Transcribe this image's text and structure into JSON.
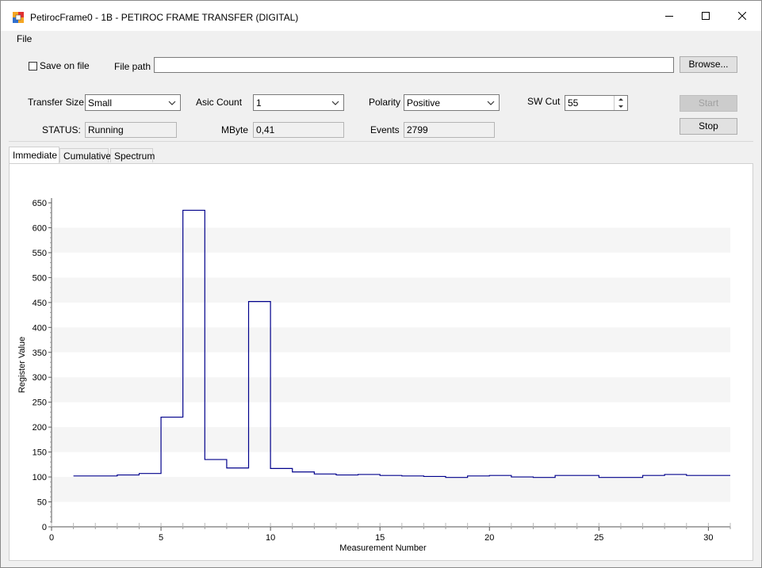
{
  "window": {
    "title": "PetirocFrame0 - 1B - PETIROC FRAME TRANSFER (DIGITAL)"
  },
  "menu": {
    "file": "File"
  },
  "controls": {
    "save_on_file": "Save on file",
    "save_on_file_checked": false,
    "file_path_label": "File path",
    "file_path_value": "",
    "browse_label": "Browse...",
    "transfer_size_label": "Transfer Size",
    "transfer_size_value": "Small",
    "asic_count_label": "Asic Count",
    "asic_count_value": "1",
    "polarity_label": "Polarity",
    "polarity_value": "Positive",
    "sw_cut_label": "SW Cut",
    "sw_cut_value": "55",
    "start_label": "Start",
    "stop_label": "Stop",
    "status_label": "STATUS:",
    "status_value": "Running",
    "mbyte_label": "MByte",
    "mbyte_value": "0,41",
    "events_label": "Events",
    "events_value": "2799"
  },
  "tabs": [
    {
      "label": "Immediate",
      "active": true
    },
    {
      "label": "Cumulative",
      "active": false
    },
    {
      "label": "Spectrum",
      "active": false
    }
  ],
  "colors": {
    "series": "#00008b",
    "stripe": "#f5f5f5"
  },
  "chart_data": {
    "type": "line",
    "step": true,
    "xlabel": "Measurement Number",
    "ylabel": "Register Value",
    "xlim": [
      0,
      31
    ],
    "ylim": [
      0,
      650
    ],
    "xticks": [
      0,
      5,
      10,
      15,
      20,
      25,
      30
    ],
    "yticks": [
      0,
      50,
      100,
      150,
      200,
      250,
      300,
      350,
      400,
      450,
      500,
      550,
      600,
      650
    ],
    "grid": false,
    "series": [
      {
        "x": [
          1,
          2,
          3,
          4,
          5,
          6,
          7,
          8,
          9,
          10,
          11,
          12,
          13,
          14,
          15,
          16,
          17,
          18,
          19,
          20,
          21,
          22,
          23,
          24,
          25,
          26,
          27,
          28,
          29,
          30
        ],
        "values": [
          102,
          102,
          104,
          107,
          220,
          635,
          135,
          118,
          452,
          117,
          110,
          106,
          104,
          105,
          103,
          102,
          101,
          99,
          102,
          103,
          100,
          99,
          103,
          103,
          99,
          99,
          103,
          105,
          103,
          103
        ]
      }
    ]
  }
}
